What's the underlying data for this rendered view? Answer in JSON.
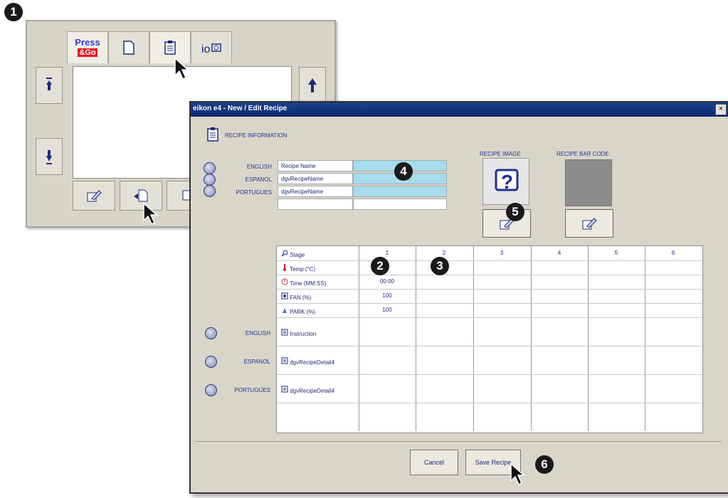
{
  "back_panel": {
    "tabs": [
      {
        "name": "press-go",
        "label_top": "Press",
        "label_bottom": "&Go"
      },
      {
        "name": "page",
        "icon": "page-icon"
      },
      {
        "name": "recipe-list",
        "icon": "clipboard-icon"
      },
      {
        "name": "camera",
        "icon": "io-camera-icon"
      }
    ]
  },
  "dialog": {
    "title": "eikon e4 - New / Edit Recipe",
    "close_label": "×",
    "section_title": "RECIPE INFORMATION",
    "languages": [
      "ENGLISH",
      "ESPANOL",
      "PORTUGUES"
    ],
    "name_fields": [
      "Recipe Name",
      "dgvRecipeName",
      "dgvRecipeName"
    ],
    "recipe_image_label": "RECIPE IMAGE",
    "recipe_barcode_label": "RECIPE BAR CODE",
    "grid": {
      "column_headers": [
        "1",
        "2",
        "3",
        "4",
        "5",
        "6"
      ],
      "rows": [
        {
          "label": "Stage",
          "icon": "magnifier-icon",
          "value": ""
        },
        {
          "label": "Temp (°C)",
          "icon": "thermometer-icon",
          "value": ""
        },
        {
          "label": "Time (MM:SS)",
          "icon": "clock-icon",
          "value": "00:00"
        },
        {
          "label": "FAN (%)",
          "icon": "fan-icon",
          "value": "100"
        },
        {
          "label": "PARK (%)",
          "icon": "park-icon",
          "value": "100"
        }
      ],
      "detail_rows": [
        {
          "language": "ENGLISH",
          "label": "Instruction"
        },
        {
          "language": "ESPANOL",
          "label": "dgvRecipeDetail4"
        },
        {
          "language": "PORTUGUES",
          "label": "dgvRecipeDetail4"
        }
      ]
    },
    "buttons": {
      "cancel": "Cancel",
      "save": "Save Recipe"
    }
  },
  "callouts": [
    "1",
    "2",
    "3",
    "4",
    "5",
    "6"
  ]
}
